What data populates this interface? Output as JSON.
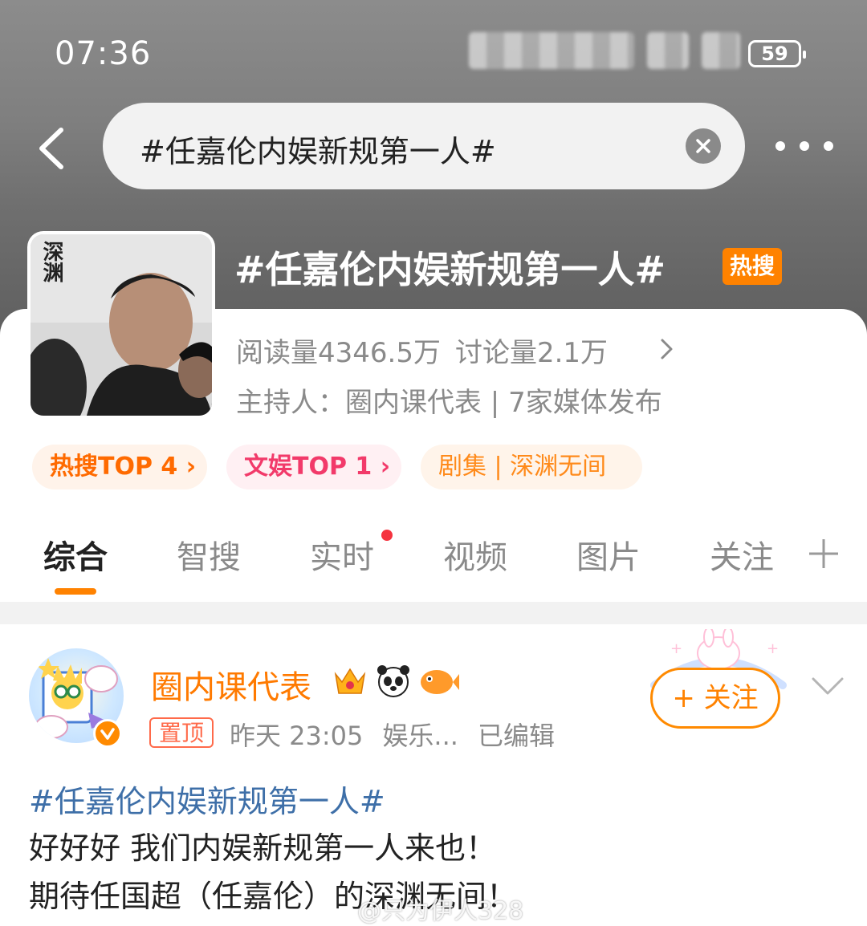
{
  "status_bar": {
    "time": "07:36",
    "battery": "59"
  },
  "search": {
    "query": "#任嘉伦内娱新规第一人#"
  },
  "topic": {
    "title": "#任嘉伦内娱新规第一人#",
    "hot_badge": "热搜",
    "reads": "阅读量4346.5万",
    "discussions": "讨论量2.1万",
    "host": "主持人：圈内课代表 | 7家媒体发布",
    "cover_text": "深渊"
  },
  "tags": {
    "hot_search": "热搜TOP 4 ›",
    "entertainment": "文娱TOP 1 ›",
    "series": "剧集 | 深渊无间"
  },
  "tabs": [
    "综合",
    "智搜",
    "实时",
    "视频",
    "图片",
    "关注"
  ],
  "post": {
    "author": "圈内课代表",
    "pinned": "置顶",
    "time": "昨天 23:05",
    "source": "娱乐...",
    "edited": "已编辑",
    "follow": "+ 关注",
    "topic": "#任嘉伦内娱新规第一人#",
    "line1": "好好好 我们内娱新规第一人来也！",
    "line2": "期待任国超（任嘉伦）的深渊无间！"
  },
  "watermark": "@只为伊人328",
  "colors": {
    "accent": "#ff8200",
    "link": "#3e6fa8",
    "hot_red": "#f23a6a"
  }
}
